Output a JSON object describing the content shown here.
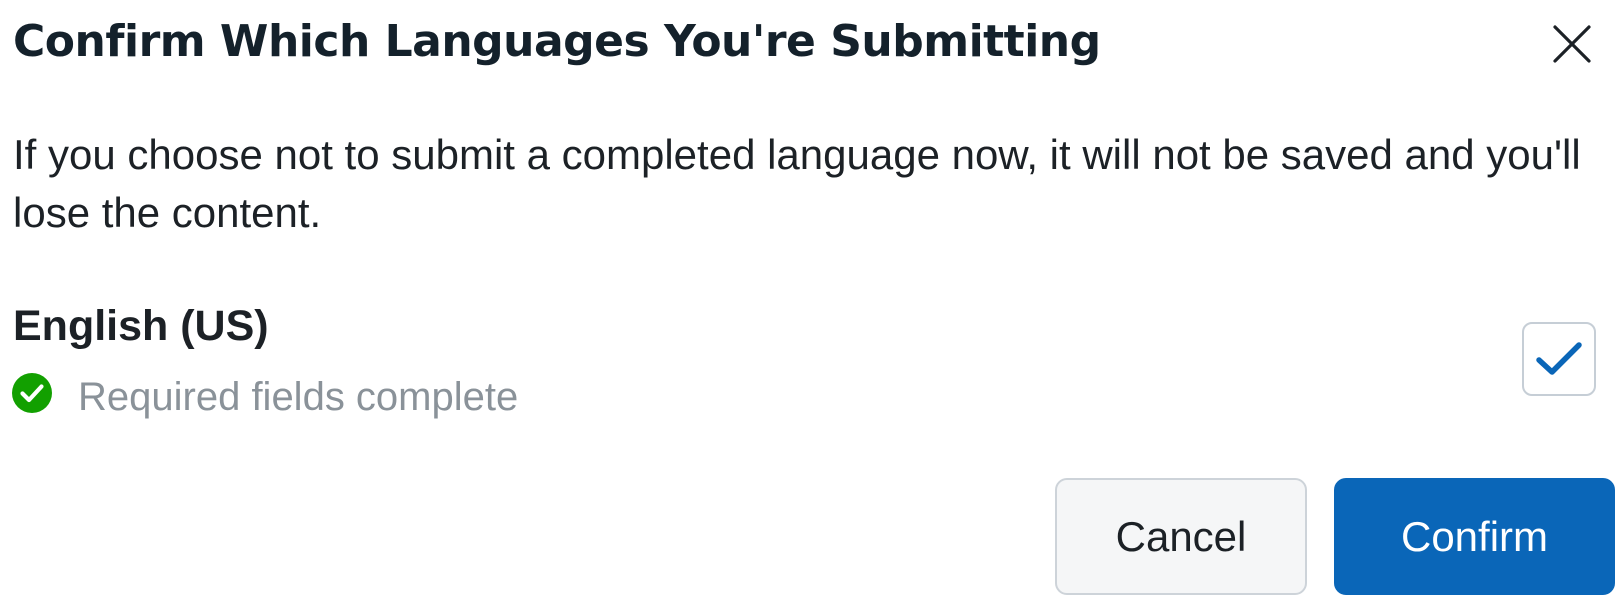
{
  "dialog": {
    "title": "Confirm Which Languages You're Submitting",
    "close_icon": "close-icon",
    "message": "If you choose not to submit a completed language now, it will not be saved and you'll lose the content."
  },
  "language": {
    "name": "English (US)",
    "status_icon": "check-circle-icon",
    "status_text": "Required fields complete",
    "selected": true
  },
  "buttons": {
    "cancel_label": "Cancel",
    "confirm_label": "Confirm"
  },
  "colors": {
    "title": "#14212b",
    "text": "#1c2126",
    "muted_text": "#8a9299",
    "success": "#12a000",
    "primary": "#0a66b8",
    "checkbox_border": "#c6ced6"
  }
}
